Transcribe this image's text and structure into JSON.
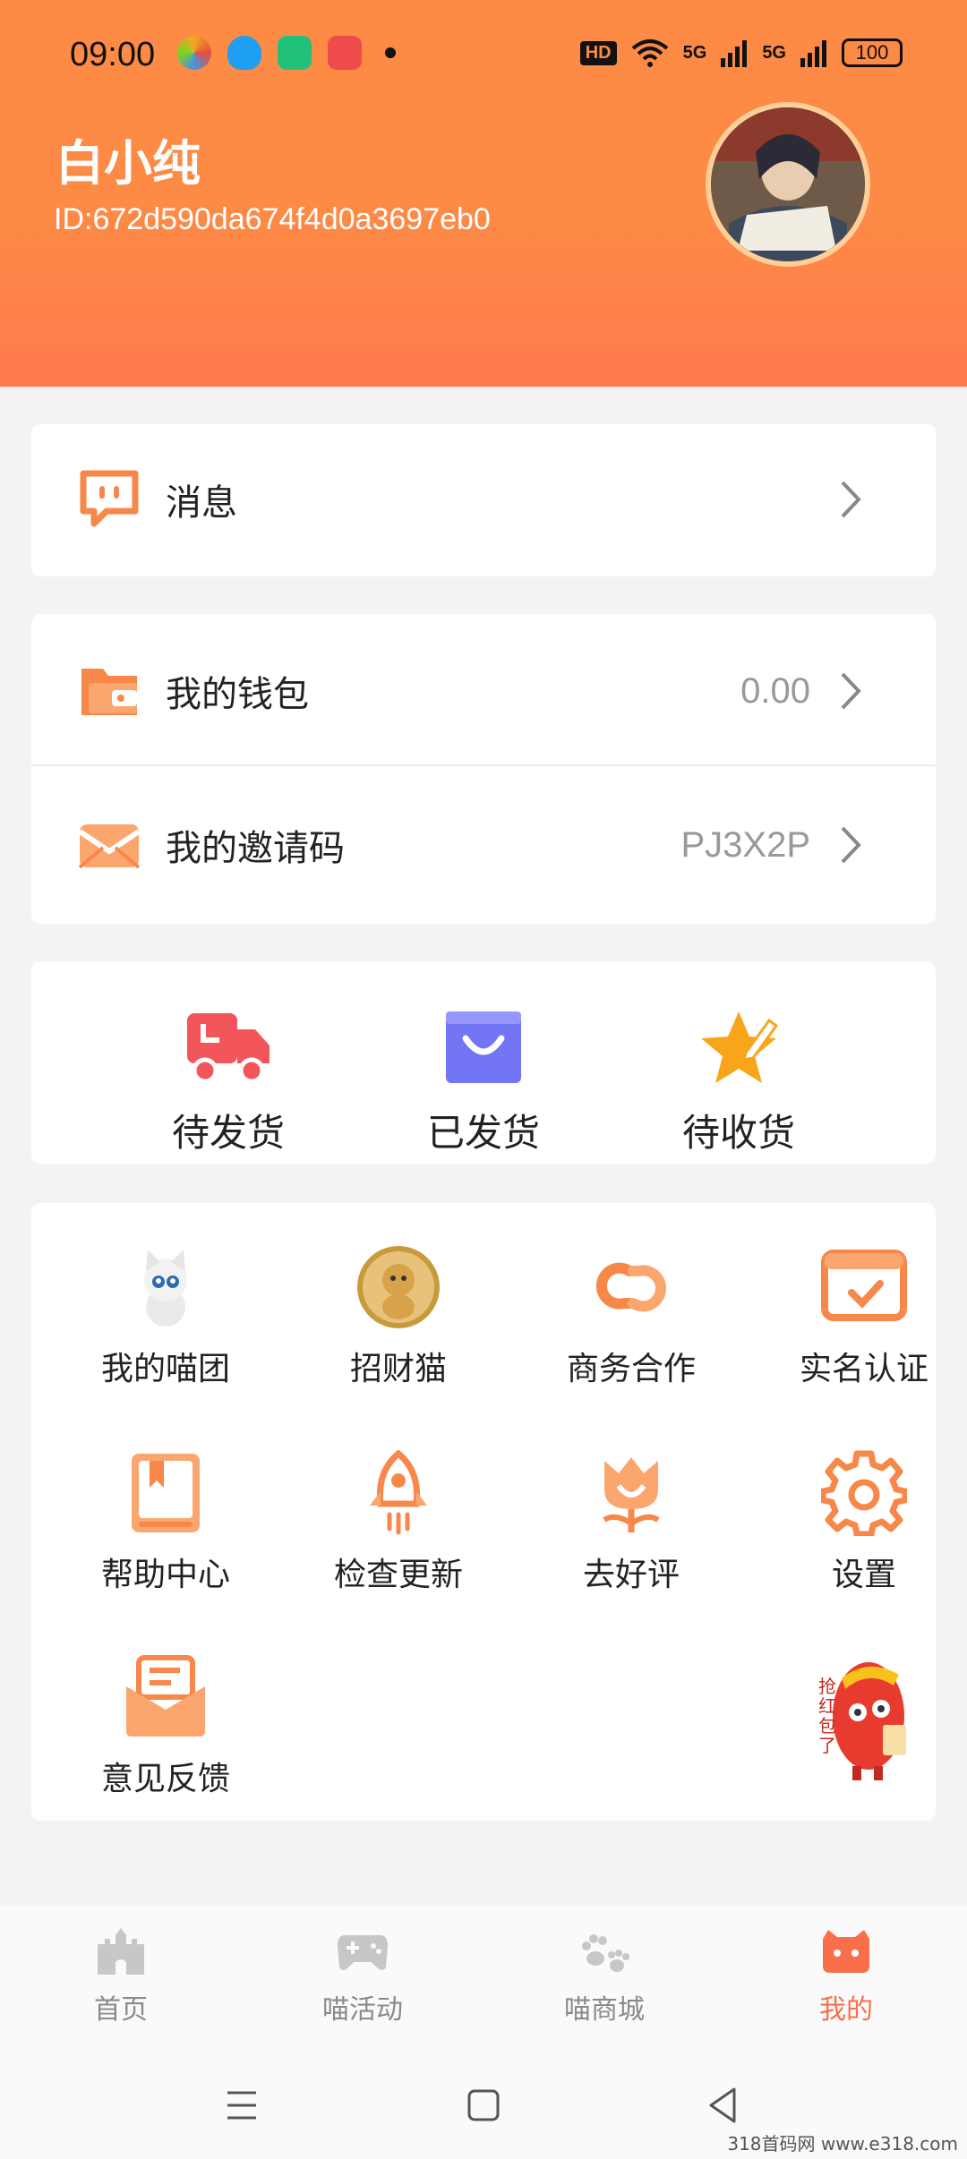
{
  "status_bar": {
    "time": "09:00",
    "hd": "HD",
    "net1": "5G",
    "net2": "5G",
    "battery": "100"
  },
  "profile": {
    "name": "白小纯",
    "id": "ID:672d590da674f4d0a3697eb0"
  },
  "menu": {
    "messages": "消息",
    "wallet": "我的钱包",
    "wallet_value": "0.00",
    "invite": "我的邀请码",
    "invite_value": "PJ3X2P"
  },
  "orders": [
    {
      "label": "待发货",
      "icon": "delivery-truck-icon"
    },
    {
      "label": "已发货",
      "icon": "shopping-bag-icon"
    },
    {
      "label": "待收货",
      "icon": "star-pen-icon"
    }
  ],
  "tools": [
    {
      "label": "我的喵团",
      "icon": "cat-icon"
    },
    {
      "label": "招财猫",
      "icon": "lucky-cat-icon"
    },
    {
      "label": "商务合作",
      "icon": "link-icon"
    },
    {
      "label": "实名认证",
      "icon": "verify-card-icon"
    },
    {
      "label": "帮助中心",
      "icon": "book-icon"
    },
    {
      "label": "检查更新",
      "icon": "rocket-icon"
    },
    {
      "label": "去好评",
      "icon": "tulip-icon"
    },
    {
      "label": "设置",
      "icon": "gear-icon"
    },
    {
      "label": "意见反馈",
      "icon": "feedback-envelope-icon"
    }
  ],
  "red_packet": {
    "text": "抢红包了"
  },
  "tabs": [
    {
      "label": "首页",
      "icon": "castle-icon",
      "active": false
    },
    {
      "label": "喵活动",
      "icon": "gamepad-icon",
      "active": false
    },
    {
      "label": "喵商城",
      "icon": "paw-icon",
      "active": false
    },
    {
      "label": "我的",
      "icon": "cat-face-icon",
      "active": true
    }
  ],
  "watermark": "318首码网  www.e318.com",
  "colors": {
    "accent": "#fd8a45",
    "tab_active": "#f86f4a",
    "icon_orange": "#f7884a"
  }
}
